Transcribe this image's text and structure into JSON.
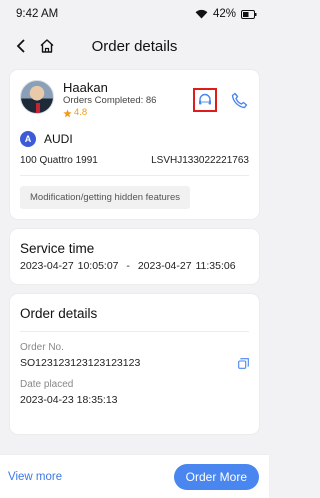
{
  "status_bar": {
    "time": "9:42 AM",
    "battery": "42%"
  },
  "nav": {
    "title": "Order details",
    "back_icon": "chevron-left-icon",
    "home_icon": "home-icon"
  },
  "driver": {
    "name": "Haakan",
    "orders_completed": "Orders Completed: 86",
    "rating": "4.8",
    "support_icon": "headset-icon",
    "phone_icon": "phone-icon"
  },
  "car": {
    "badge": "A",
    "brand": "AUDI",
    "model": "100 Quattro 1991",
    "vin": "LSVHJ133022221763",
    "tag": "Modification/getting hidden features"
  },
  "service": {
    "title": "Service time",
    "start": "2023-04-27 10:05:07",
    "separator": "-",
    "end": "2023-04-27 11:35:06"
  },
  "order_details": {
    "title": "Order details",
    "order_no_label": "Order No.",
    "order_no_value": "SO123123123123123123",
    "date_label": "Date placed",
    "date_value": "2023-04-23 18:35:13"
  },
  "bottom": {
    "view_more": "View more",
    "order_more": "Order More"
  },
  "colors": {
    "accent": "#4a86f0",
    "rating": "#f29a1b",
    "highlight": "#e01b1b"
  }
}
